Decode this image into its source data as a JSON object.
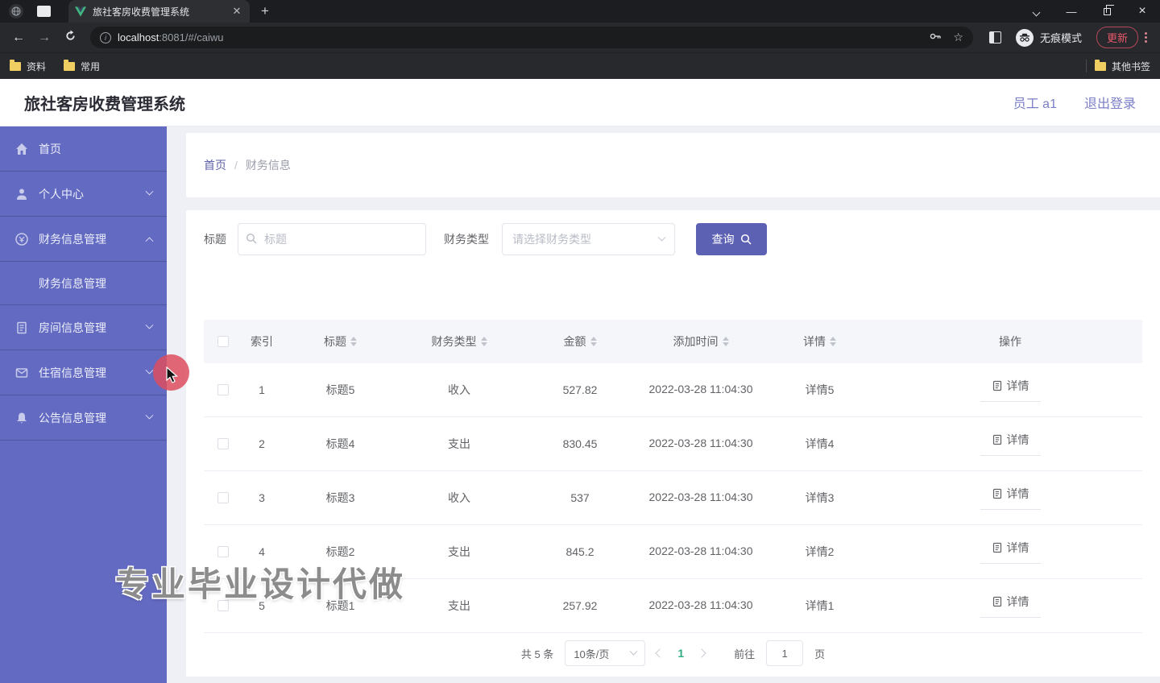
{
  "browser": {
    "tab_title": "旅社客房收费管理系统",
    "url_host": "localhost",
    "url_rest": ":8081/#/caiwu",
    "incognito_label": "无痕模式",
    "update_label": "更新",
    "bookmarks": [
      {
        "label": "资料"
      },
      {
        "label": "常用"
      }
    ],
    "other_bookmarks_label": "其他书签"
  },
  "header": {
    "title": "旅社客房收费管理系统",
    "user": "员工 a1",
    "logout": "退出登录"
  },
  "sidebar": {
    "items": [
      {
        "label": "首页",
        "icon": "home-icon"
      },
      {
        "label": "个人中心",
        "icon": "user-icon",
        "state": "collapsed"
      },
      {
        "label": "财务信息管理",
        "icon": "coin-icon",
        "state": "expanded"
      },
      {
        "label": "财务信息管理",
        "icon": "",
        "child": true
      },
      {
        "label": "房间信息管理",
        "icon": "document-icon",
        "state": "collapsed"
      },
      {
        "label": "住宿信息管理",
        "icon": "mail-icon",
        "state": "collapsed"
      },
      {
        "label": "公告信息管理",
        "icon": "bell-icon",
        "state": "collapsed"
      }
    ]
  },
  "breadcrumb": {
    "items": [
      {
        "label": "首页"
      },
      {
        "label": "财务信息"
      }
    ],
    "separator": "/"
  },
  "search": {
    "title_label": "标题",
    "title_placeholder": "标题",
    "type_label": "财务类型",
    "type_placeholder": "请选择财务类型",
    "query_label": "查询"
  },
  "table": {
    "columns": {
      "index": "索引",
      "title": "标题",
      "type": "财务类型",
      "amount": "金额",
      "time": "添加时间",
      "detail": "详情",
      "action": "操作"
    },
    "action_label": "详情",
    "rows": [
      {
        "index": "1",
        "title": "标题5",
        "type": "收入",
        "amount": "527.82",
        "time": "2022-03-28 11:04:30",
        "detail": "详情5"
      },
      {
        "index": "2",
        "title": "标题4",
        "type": "支出",
        "amount": "830.45",
        "time": "2022-03-28 11:04:30",
        "detail": "详情4"
      },
      {
        "index": "3",
        "title": "标题3",
        "type": "收入",
        "amount": "537",
        "time": "2022-03-28 11:04:30",
        "detail": "详情3"
      },
      {
        "index": "4",
        "title": "标题2",
        "type": "支出",
        "amount": "845.2",
        "time": "2022-03-28 11:04:30",
        "detail": "详情2"
      },
      {
        "index": "5",
        "title": "标题1",
        "type": "支出",
        "amount": "257.92",
        "time": "2022-03-28 11:04:30",
        "detail": "详情1"
      }
    ]
  },
  "pagination": {
    "total": "共 5 条",
    "page_size": "10条/页",
    "current_page": "1",
    "goto_label": "前往",
    "goto_value": "1",
    "page_label": "页"
  },
  "watermark": "专业毕业设计代做",
  "colors": {
    "sidebar_purple": "#636ac1",
    "button_purple": "#5c61b4",
    "link_purple": "#7a7ec6",
    "pager_active_green": "#2eae82",
    "update_red": "#e8596b",
    "vue_green": "#41b883",
    "folder_yellow": "#f0ce62",
    "click_indicator_red": "#dd4d5f"
  }
}
